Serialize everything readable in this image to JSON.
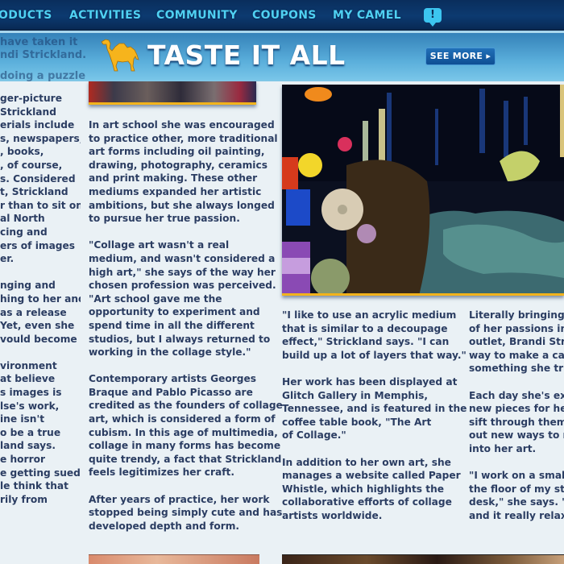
{
  "nav": {
    "items": [
      {
        "label": "ODUCTS"
      },
      {
        "label": "ACTIVITIES"
      },
      {
        "label": "COMMUNITY"
      },
      {
        "label": "COUPONS"
      },
      {
        "label": "MY CAMEL"
      }
    ],
    "alert_glyph": "!"
  },
  "banner": {
    "title": "TASTE IT ALL",
    "see_more_label": "SEE MORE ▸",
    "ghost_lines": [
      "have taken it",
      "ndi Strickland.",
      "doing a puzzle"
    ]
  },
  "colors": {
    "nav_text": "#4fd0f2",
    "body_text": "#2b3d62",
    "accent_gold": "#f2b31c",
    "banner_blue": "#2578b4"
  },
  "article": {
    "left_column": [
      "ger-picture\nStrickland\nerials include\ns, newspapers,\n, books,\n, of course,\ns. Considered\nt, Strickland\nr than to sit on\nal North\ncing and\ners of images\ner.",
      "nging and\nhing to her and\nas a release\nYet, even she\nvould become",
      "vironment\nat believe\ns images is\nlse's work,\nine isn't\no be a true\nland says.\ne horror\ne getting sued\nle think that\nrily from"
    ],
    "middle_column": [
      "In art school she was encouraged\nto practice other, more traditional\nart forms including oil painting,\ndrawing, photography, ceramics\nand print making. These other\nmediums expanded her artistic\nambitions, but she always longed\nto pursue her true passion.",
      "\"Collage art wasn't a real\nmedium, and wasn't considered a\nhigh art,\" she says of the way her\nchosen profession was perceived.\n\"Art school gave me the\nopportunity to experiment and\nspend time in all the different\nstudios, but I always returned to\nworking in the collage style.\"",
      "Contemporary artists Georges\nBraque and Pablo Picasso are\ncredited as the founders of collage\nart, which is considered a form of\ncubism. In this age of multimedia,\ncollage in many forms has become\nquite trendy, a fact that Strickland\nfeels legitimizes her craft.",
      "After years of practice, her work\nstopped being simply cute and has\ndeveloped depth and form."
    ],
    "third_column": [
      "\"I like to use an acrylic medium\nthat is similar to a decoupage\neffect,\" Strickland says. \"I can\nbuild up a lot of layers that way.\"",
      "Her work has been displayed at\nGlitch Gallery in Memphis,\nTennessee, and is featured in the\ncoffee table book, \"The Art\nof Collage.\"",
      "In addition to her own art, she\nmanages a website called Paper\nWhistle, which highlights the\ncollaborative efforts of collage\nartists worldwide."
    ],
    "fourth_column": [
      "Literally bringing to\nof her passions into\noutlet, Brandi Stric\nway to make a care\nsomething she truly",
      "Each day she's exci\nnew pieces for her\nsift through them a\nout new ways to ma\ninto her art.",
      "\"I work on a small s\nthe floor of my stud\ndesk,\" she says. \"I \nand it really relaxe"
    ]
  }
}
